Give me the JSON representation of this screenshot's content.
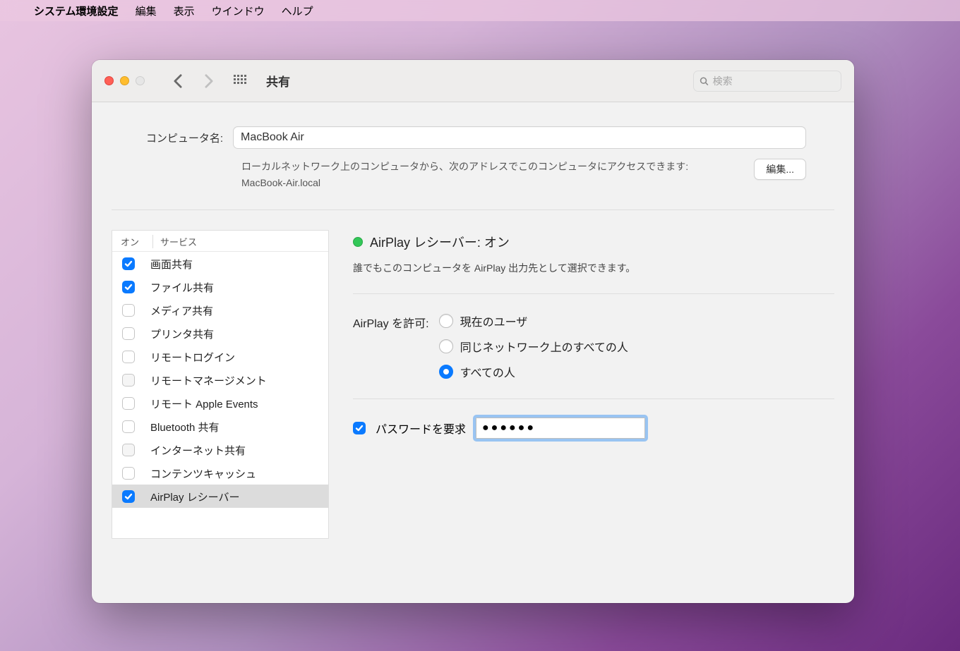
{
  "menubar": {
    "app": "システム環境設定",
    "items": [
      "編集",
      "表示",
      "ウインドウ",
      "ヘルプ"
    ]
  },
  "toolbar": {
    "title": "共有",
    "search_placeholder": "検索"
  },
  "computer": {
    "label": "コンピュータ名:",
    "value": "MacBook Air",
    "address_text": "ローカルネットワーク上のコンピュータから、次のアドレスでこのコンピュータにアクセスできます: MacBook-Air.local",
    "edit_button": "編集..."
  },
  "services": {
    "header_on": "オン",
    "header_service": "サービス",
    "items": [
      {
        "label": "画面共有",
        "checked": true,
        "disabled": false,
        "selected": false
      },
      {
        "label": "ファイル共有",
        "checked": true,
        "disabled": false,
        "selected": false
      },
      {
        "label": "メディア共有",
        "checked": false,
        "disabled": false,
        "selected": false
      },
      {
        "label": "プリンタ共有",
        "checked": false,
        "disabled": false,
        "selected": false
      },
      {
        "label": "リモートログイン",
        "checked": false,
        "disabled": false,
        "selected": false
      },
      {
        "label": "リモートマネージメント",
        "checked": false,
        "disabled": true,
        "selected": false
      },
      {
        "label": "リモート Apple Events",
        "checked": false,
        "disabled": false,
        "selected": false
      },
      {
        "label": "Bluetooth 共有",
        "checked": false,
        "disabled": false,
        "selected": false
      },
      {
        "label": "インターネット共有",
        "checked": false,
        "disabled": true,
        "selected": false
      },
      {
        "label": "コンテンツキャッシュ",
        "checked": false,
        "disabled": false,
        "selected": false
      },
      {
        "label": "AirPlay レシーバー",
        "checked": true,
        "disabled": false,
        "selected": true
      }
    ]
  },
  "detail": {
    "status_title": "AirPlay レシーバー: オン",
    "status_desc": "誰でもこのコンピュータを AirPlay 出力先として選択できます。",
    "allow_label": "AirPlay を許可:",
    "radios": [
      {
        "label": "現在のユーザ",
        "checked": false
      },
      {
        "label": "同じネットワーク上のすべての人",
        "checked": false
      },
      {
        "label": "すべての人",
        "checked": true
      }
    ],
    "password_checkbox_label": "パスワードを要求",
    "password_checked": true,
    "password_value": "●●●●●●"
  }
}
